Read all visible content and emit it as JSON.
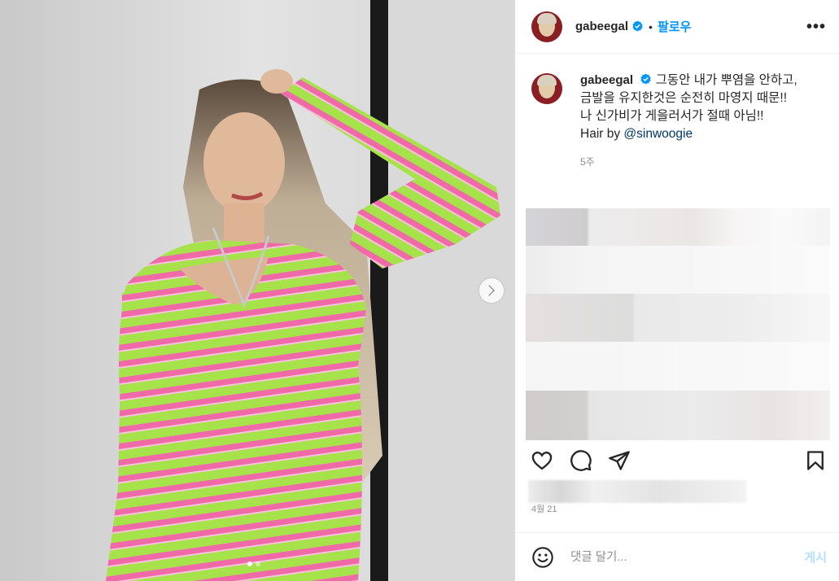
{
  "post": {
    "username": "gabeegal",
    "follow_label": "팔로우",
    "separator": "•",
    "more_label": "•••"
  },
  "caption": {
    "username": "gabeegal",
    "line1": "그동안 내가 뿌염을 안하고,",
    "line2": "금발을 유지한것은 순전히 마영지 때문!!",
    "line3": "나 신가비가 게을러서가 절때 아님!!",
    "hair_prefix": "Hair by ",
    "mention": "@sinwoogie",
    "time": "5주"
  },
  "meta": {
    "date": "4월 21"
  },
  "comment": {
    "placeholder": "댓글 달기...",
    "post_label": "게시"
  },
  "carousel": {
    "current": 1,
    "total": 2
  },
  "colors": {
    "accent": "#0095f6",
    "post_disabled": "#b2dffc",
    "stripe_green": "#a6e34a",
    "stripe_pink": "#f06aa8"
  }
}
